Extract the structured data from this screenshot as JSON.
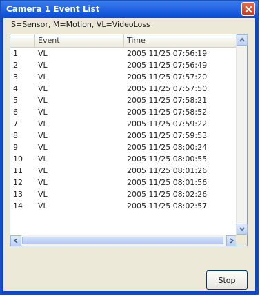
{
  "window": {
    "title": "Camera 1  Event List"
  },
  "legend": "S=Sensor, M=Motion, VL=VideoLoss",
  "table": {
    "columns": [
      "",
      "Event",
      "Time"
    ],
    "rows": [
      {
        "no": "1",
        "event": "VL",
        "time": "2005 11/25 07:56:19"
      },
      {
        "no": "2",
        "event": "VL",
        "time": "2005 11/25 07:56:49"
      },
      {
        "no": "3",
        "event": "VL",
        "time": "2005 11/25 07:57:20"
      },
      {
        "no": "4",
        "event": "VL",
        "time": "2005 11/25 07:57:50"
      },
      {
        "no": "5",
        "event": "VL",
        "time": "2005 11/25 07:58:21"
      },
      {
        "no": "6",
        "event": "VL",
        "time": "2005 11/25 07:58:52"
      },
      {
        "no": "7",
        "event": "VL",
        "time": "2005 11/25 07:59:22"
      },
      {
        "no": "8",
        "event": "VL",
        "time": "2005 11/25 07:59:53"
      },
      {
        "no": "9",
        "event": "VL",
        "time": "2005 11/25 08:00:24"
      },
      {
        "no": "10",
        "event": "VL",
        "time": "2005 11/25 08:00:55"
      },
      {
        "no": "11",
        "event": "VL",
        "time": "2005 11/25 08:01:26"
      },
      {
        "no": "12",
        "event": "VL",
        "time": "2005 11/25 08:01:56"
      },
      {
        "no": "13",
        "event": "VL",
        "time": "2005 11/25 08:02:26"
      },
      {
        "no": "14",
        "event": "VL",
        "time": "2005 11/25 08:02:57"
      }
    ]
  },
  "buttons": {
    "stop_label": "Stop"
  },
  "colors": {
    "titlebar": "#0a4bd3",
    "client": "#ece9d8",
    "close": "#c23a1c"
  },
  "icons": {
    "close": "close-icon",
    "up": "arrow-up-icon",
    "down": "arrow-down-icon",
    "left": "arrow-left-icon",
    "right": "arrow-right-icon"
  }
}
